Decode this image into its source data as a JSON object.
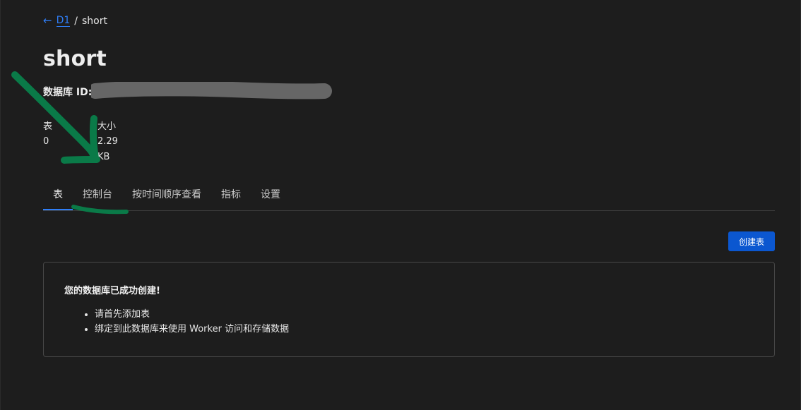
{
  "breadcrumb": {
    "back_arrow": "←",
    "parent": "D1",
    "separator": "/",
    "current": "short"
  },
  "page": {
    "title": "short",
    "db_id_label": "数据库 ID:"
  },
  "stats": {
    "tables_label": "表",
    "tables_value": "0",
    "size_label": "大小",
    "size_value": "2.29 KB"
  },
  "tabs": [
    {
      "label": "表",
      "active": true
    },
    {
      "label": "控制台",
      "active": false
    },
    {
      "label": "按时间顺序查看",
      "active": false
    },
    {
      "label": "指标",
      "active": false
    },
    {
      "label": "设置",
      "active": false
    }
  ],
  "actions": {
    "create_table_label": "创建表"
  },
  "info": {
    "title": "您的数据库已成功创建!",
    "items": [
      "请首先添加表",
      "绑定到此数据库来使用 Worker 访问和存储数据"
    ]
  },
  "colors": {
    "background": "#1d1d1d",
    "accent": "#2f7ef7",
    "button": "#0b57d0",
    "annotation": "#0a7a48",
    "redaction": "#666666"
  }
}
